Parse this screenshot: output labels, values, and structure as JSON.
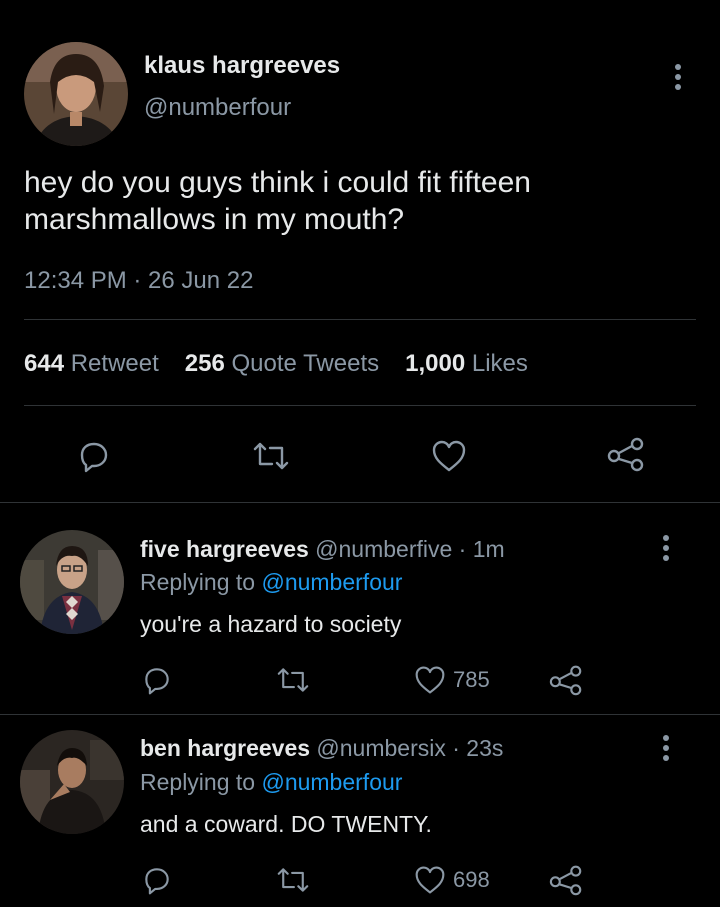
{
  "tweet": {
    "name": "klaus hargreeves",
    "handle": "@numberfour",
    "text": "hey do you guys think i could fit fifteen marshmallows in my mouth?",
    "timestamp": "12:34 PM · 26 Jun 22",
    "stats": {
      "retweets": "644",
      "retweets_label": "Retweet",
      "quotes": "256",
      "quotes_label": "Quote Tweets",
      "likes": "1,000",
      "likes_label": "Likes"
    },
    "actions": [
      "reply-icon",
      "retweet-icon",
      "like-icon",
      "share-icon"
    ]
  },
  "replies": [
    {
      "name": "five hargreeves",
      "meta": "@numberfive · 1m",
      "replying_prefix": "Replying to",
      "replying_to": "@numberfour",
      "text": "you're a hazard to society",
      "likes": "785"
    },
    {
      "name": "ben hargreeves",
      "meta": "@numbersix · 23s",
      "replying_prefix": "Replying to",
      "replying_to": "@numberfour",
      "text": "and a coward. DO TWENTY.",
      "likes": "698"
    }
  ],
  "colors": {
    "background": "#000000",
    "text": "#e7e9ea",
    "secondary": "#8b98a5",
    "link": "#1d9bf0",
    "divider": "#2f3336"
  }
}
